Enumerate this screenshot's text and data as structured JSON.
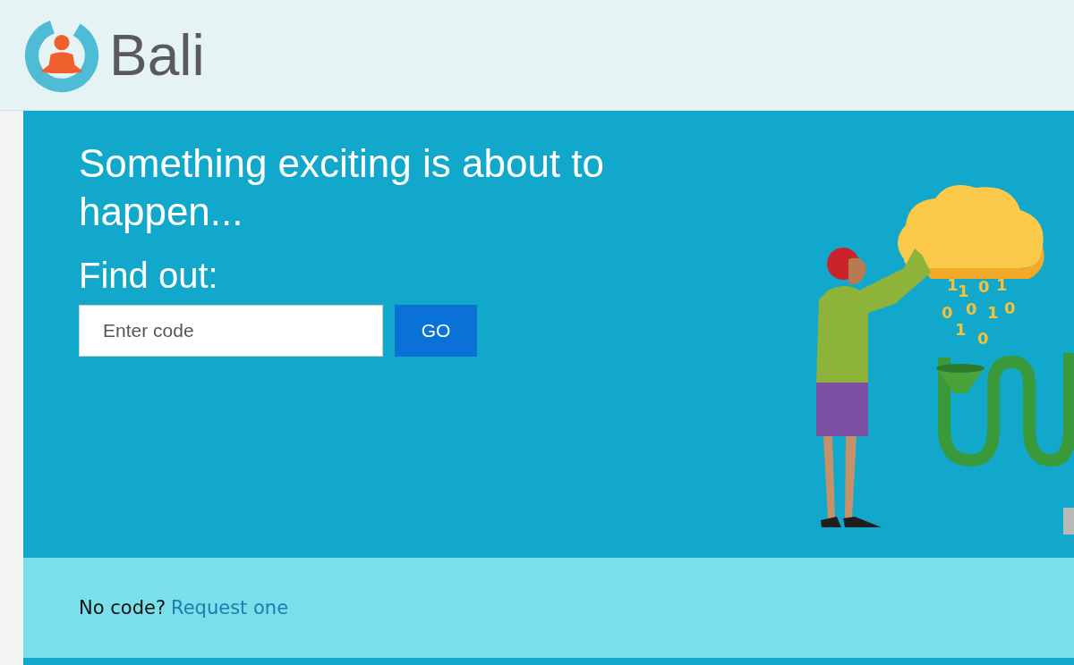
{
  "header": {
    "brand": "Bali"
  },
  "hero": {
    "headline": "Something exciting is about to happen...",
    "prompt": "Find out:",
    "code_field": {
      "placeholder": "Enter code"
    },
    "submit_button": "GO"
  },
  "illustration": {
    "digits": [
      "1",
      "1",
      "0",
      "1",
      "0",
      "0",
      "1",
      "0",
      "1",
      "0"
    ]
  },
  "footer": {
    "question": "No code?",
    "link": "Request one"
  }
}
